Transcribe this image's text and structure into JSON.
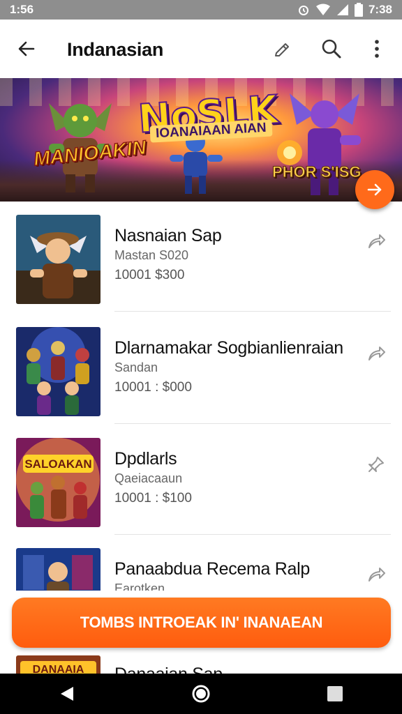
{
  "status_bar": {
    "time_left": "1:56",
    "time_right": "7:38"
  },
  "app_bar": {
    "title": "Indanasian"
  },
  "banner": {
    "logo_main": "NoSLK",
    "logo_sub": "IOANAIAAN AIAN",
    "left_text": "MANIOAKIN",
    "right_text": "PHOR S'ISG"
  },
  "items": [
    {
      "title": "Nasnaian Sap",
      "subtitle": "Mastan S020",
      "price": "10001 $300"
    },
    {
      "title": "Dlarnamakar Sogbianlienraian",
      "subtitle": "Sandan",
      "price": "10001 : $000"
    },
    {
      "title": "Dpdlarls",
      "subtitle": "Qaeiacaaun",
      "price": "10001 : $100"
    },
    {
      "title": "Panaabdua Recema Ralp",
      "subtitle": "Earotken",
      "price": ""
    },
    {
      "title": "Danaaian Sap",
      "subtitle": "",
      "price": ""
    }
  ],
  "thumb_labels": {
    "item3": "SALOAKAN",
    "item5": "DANAAIA"
  },
  "cta": {
    "label": "TOMBS INTROEAK IN' INANAEAN"
  },
  "colors": {
    "accent": "#ff6a1a",
    "status_bar": "#8e8e8e",
    "nav_bar": "#000000"
  },
  "icons": {
    "back": "arrow-left-icon",
    "edit": "pencil-icon",
    "search": "search-icon",
    "more": "more-vert-icon",
    "share": "share-arrow-icon",
    "next": "arrow-right-icon",
    "nav_back": "triangle-back-icon",
    "nav_home": "circle-home-icon",
    "nav_recent": "square-recents-icon"
  }
}
